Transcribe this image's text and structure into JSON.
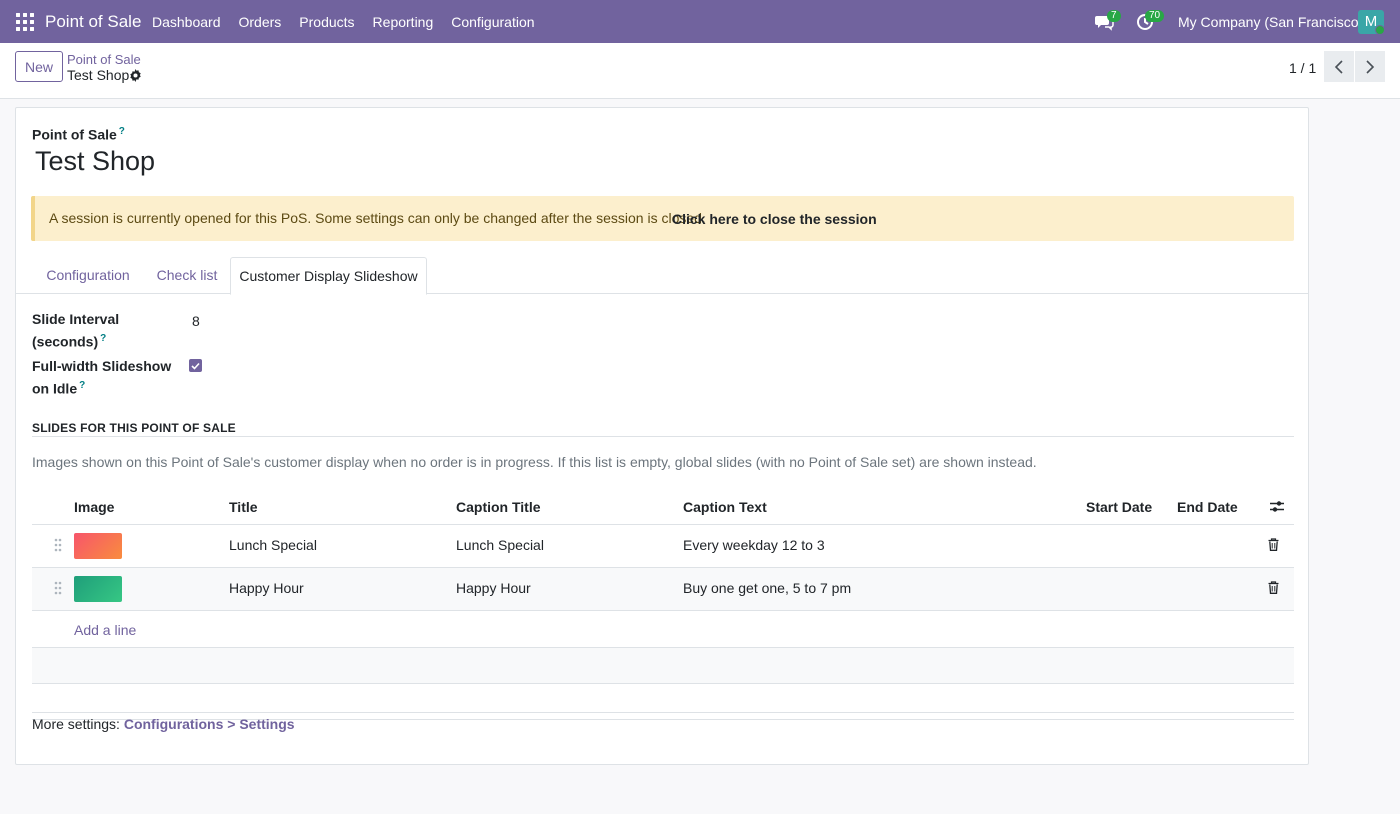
{
  "navbar": {
    "brand": "Point of Sale",
    "menu": [
      "Dashboard",
      "Orders",
      "Products",
      "Reporting",
      "Configuration"
    ],
    "messages_count": "7",
    "activities_count": "70",
    "company": "My Company (San Francisco)",
    "avatar_initial": "M"
  },
  "control_panel": {
    "new_label": "New",
    "breadcrumb_parent": "Point of Sale",
    "breadcrumb_current": "Test Shop",
    "pager": "1 / 1"
  },
  "form": {
    "name_label": "Point of Sale",
    "name_help": "?",
    "name": "Test Shop",
    "alert_text": "A session is currently opened for this PoS. Some settings can only be changed after the session is closed.",
    "alert_link": "Click here to close the session",
    "tabs": [
      "Configuration",
      "Check list",
      "Customer Display Slideshow"
    ],
    "active_tab": "Customer Display Slideshow",
    "slide_interval_label_1": "Slide Interval",
    "slide_interval_label_2": "(seconds)",
    "slide_interval_value": "8",
    "fullwidth_label_1": "Full-width Slideshow",
    "fullwidth_label_2": "on Idle",
    "fullwidth_checked": true,
    "help_mark": "?",
    "section_title": "SLIDES FOR THIS POINT OF SALE",
    "section_desc": "Images shown on this Point of Sale's customer display when no order is in progress. If this list is empty, global slides (with no Point of Sale set) are shown instead.",
    "more_settings_prefix": "More settings: ",
    "more_settings_link": "Configurations > Settings"
  },
  "table": {
    "headers": {
      "image": "Image",
      "title": "Title",
      "caption_title": "Caption Title",
      "caption_text": "Caption Text",
      "start_date": "Start Date",
      "end_date": "End Date"
    },
    "rows": [
      {
        "title": "Lunch Special",
        "caption_title": "Lunch Special",
        "caption_text": "Every weekday 12 to 3",
        "start_date": "",
        "end_date": "",
        "thumb_from": "#f7556b",
        "thumb_to": "#f98c3e"
      },
      {
        "title": "Happy Hour",
        "caption_title": "Happy Hour",
        "caption_text": "Buy one get one, 5 to 7 pm",
        "start_date": "",
        "end_date": "",
        "thumb_from": "#1f9e7a",
        "thumb_to": "#36c784"
      }
    ],
    "add_line": "Add a line"
  },
  "colors": {
    "primary": "#71639e",
    "accent": "#017e84",
    "alert_bg": "#fcefcd"
  }
}
